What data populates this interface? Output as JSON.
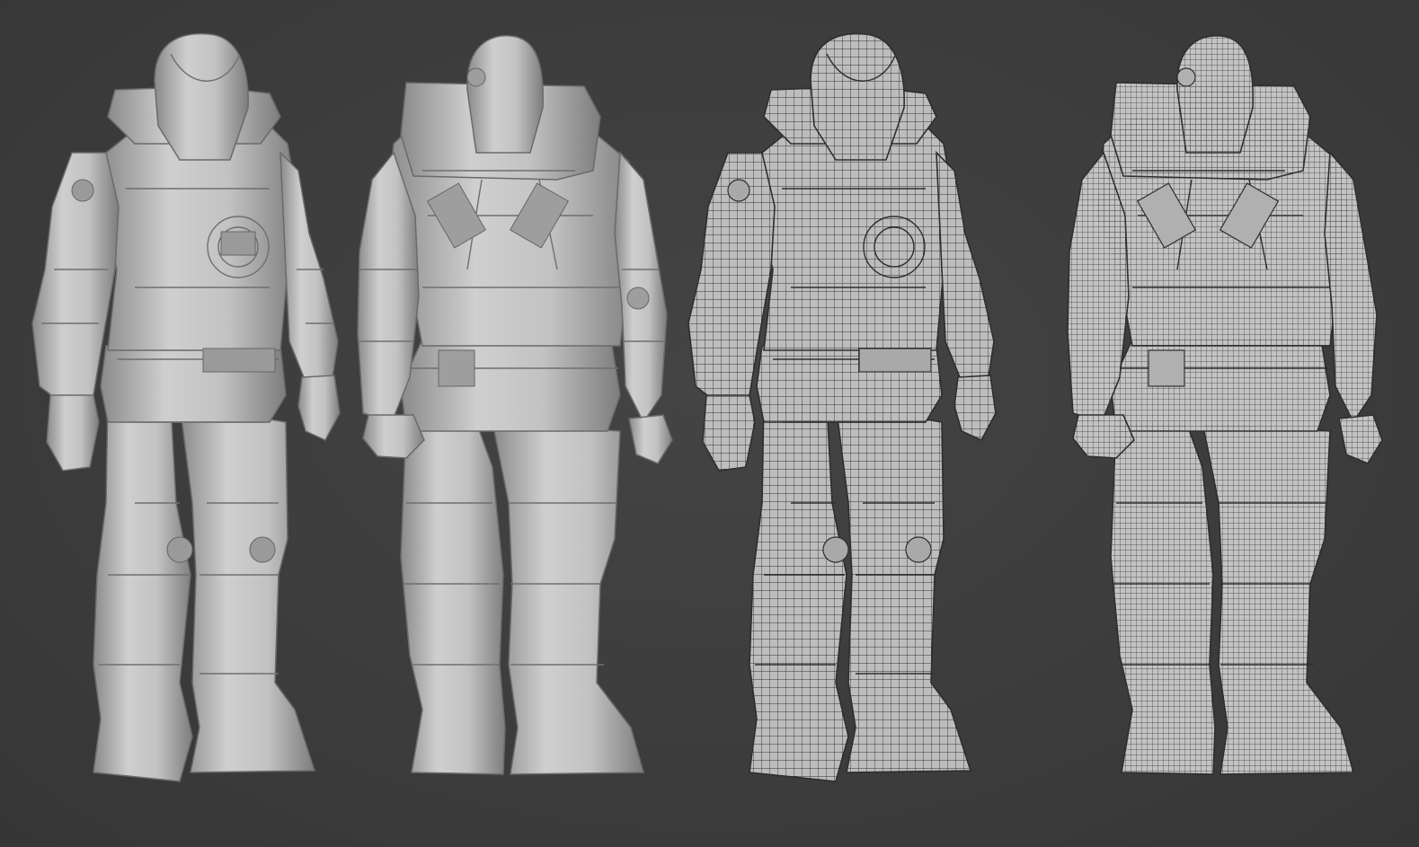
{
  "viewport": {
    "background_color": "#3d3d3d"
  },
  "render_styles": {
    "shaded_color": "#b9b9b9",
    "shade_dark": "#7a7a7a",
    "shade_light": "#d8d8d8",
    "wire_color": "#2e2e2e"
  },
  "figures": [
    {
      "view": "front-three-quarter",
      "shading": "solid"
    },
    {
      "view": "back-three-quarter",
      "shading": "solid"
    },
    {
      "view": "front-three-quarter",
      "shading": "wireframe"
    },
    {
      "view": "back-three-quarter",
      "shading": "wireframe"
    }
  ]
}
